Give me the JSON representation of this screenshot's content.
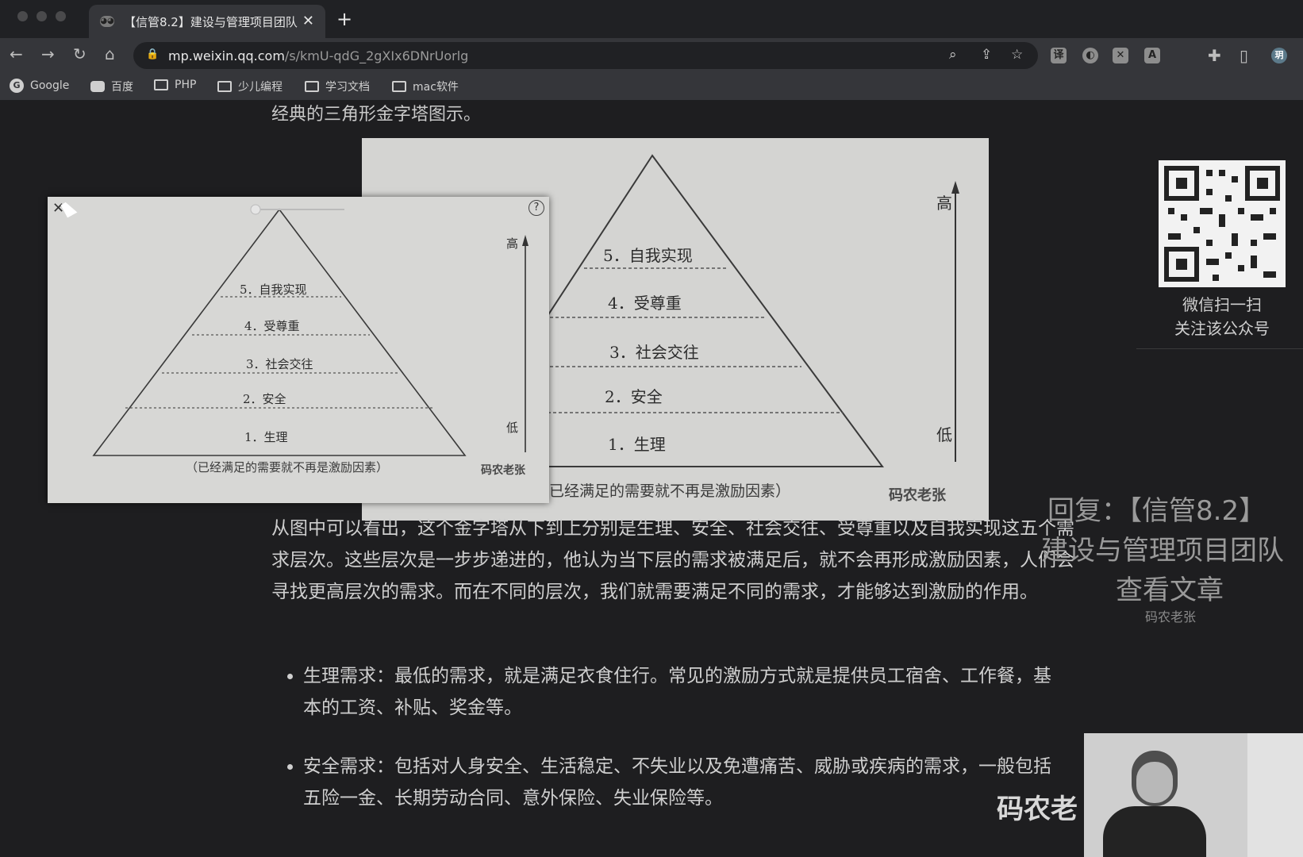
{
  "browser": {
    "tab_title": "【信管8.2】建设与管理项目团队",
    "tab_close": "✕",
    "new_tab": "+",
    "url_host": "mp.weixin.qq.com",
    "url_path": "/s/kmU-qdG_2gXIx6DNrUorlg",
    "bookmarks": [
      "Google",
      "百度",
      "PHP",
      "少儿编程",
      "学习文档",
      "mac软件"
    ],
    "profile_initial": "玥"
  },
  "article": {
    "intro": "经典的三角形金字塔图示。",
    "pyramid": {
      "levels": [
        "5．自我实现",
        "4．受尊重",
        "3．社会交往",
        "2．安全",
        "1．生理"
      ],
      "high": "高",
      "low": "低",
      "caption_popup": "（已经满足的需要就不再是激励因素）",
      "caption_main": "已经满足的需要就不再是激励因素）",
      "watermark": "码农老张"
    },
    "popup": {
      "close": "✕",
      "help": "?"
    },
    "paragraph": "从图中可以看出，这个金字塔从下到上分别是生理、安全、社会交往、受尊重以及自我实现这五个需求层次。这些层次是一步步递进的，他认为当下层的需求被满足后，就不会再形成激励因素，人们会寻找更高层次的需求。而在不同的层次，我们就需要满足不同的需求，才能够达到激励的作用。",
    "bullets": [
      "生理需求：最低的需求，就是满足衣食住行。常见的激励方式就是提供员工宿舍、工作餐，基本的工资、补贴、奖金等。",
      "安全需求：包括对人身安全、生活稳定、不失业以及免遭痛苦、威胁或疾病的需求，一般包括五险一金、长期劳动合同、意外保险、失业保险等。"
    ]
  },
  "sidebar": {
    "qr_line1": "微信扫一扫",
    "qr_line2": "关注该公众号",
    "promo_line1": "回复：【信管8.2】",
    "promo_line2": "建设与管理项目团队",
    "promo_line3": "查看文章",
    "promo_author": "码农老张"
  },
  "video": {
    "overlay_text": "码农老"
  }
}
